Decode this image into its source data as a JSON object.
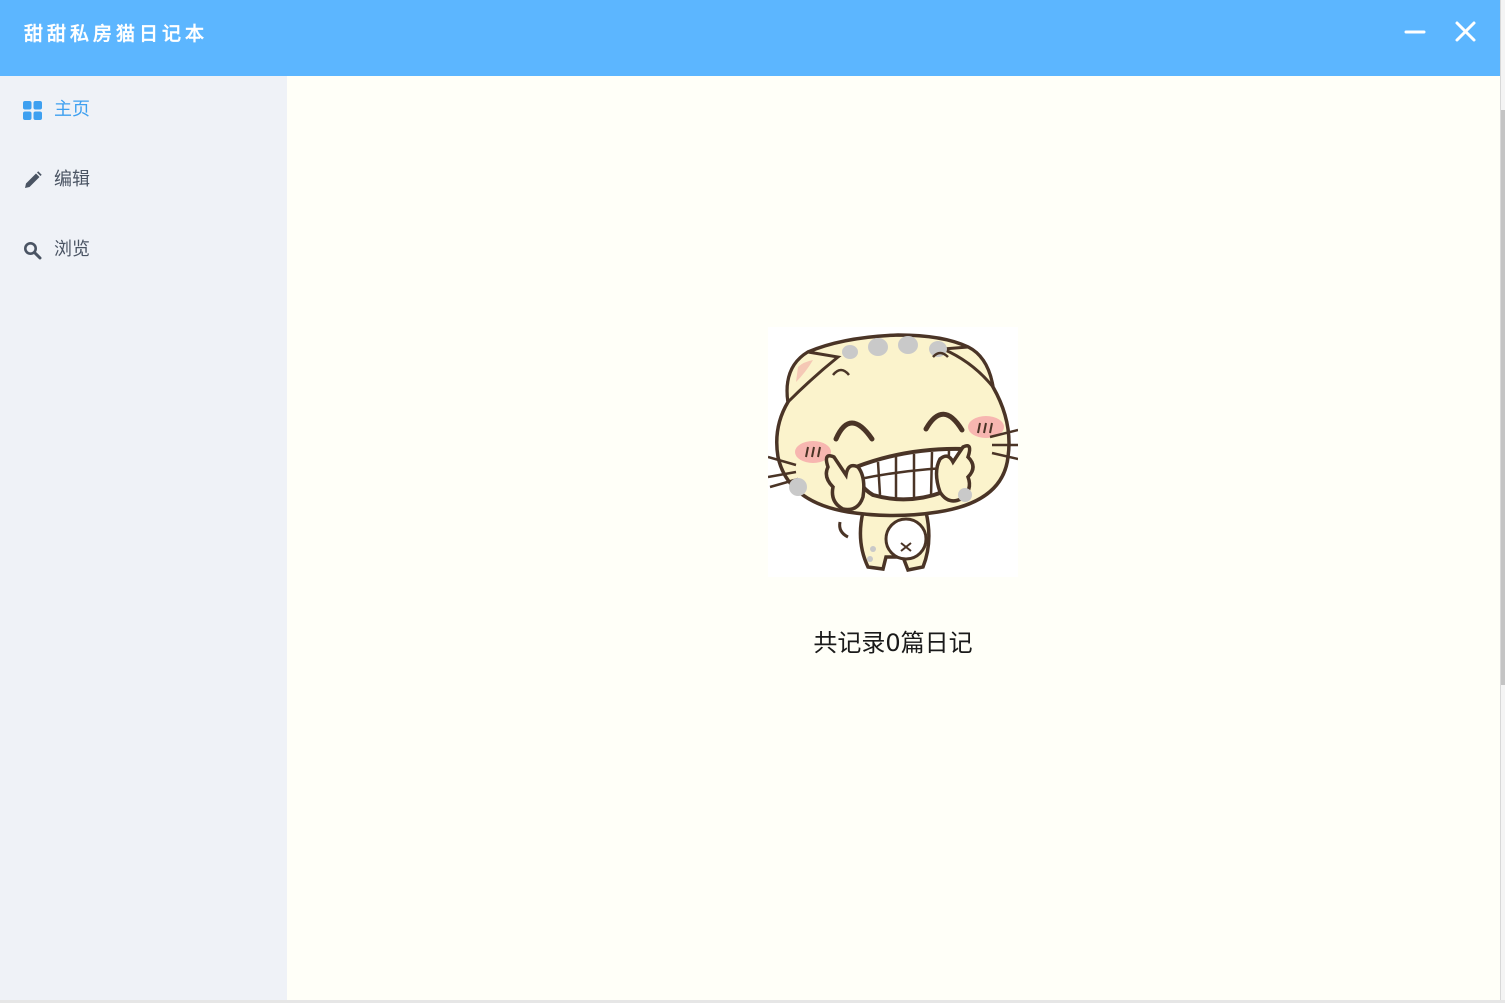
{
  "window": {
    "title": "甜甜私房猫日记本",
    "accent_color": "#5cb6ff",
    "minimize_icon": "minus",
    "close_icon": "x"
  },
  "sidebar": {
    "items": [
      {
        "label": "主页",
        "icon": "grid-icon",
        "active": true
      },
      {
        "label": "编辑",
        "icon": "pencil-icon",
        "active": false
      },
      {
        "label": "浏览",
        "icon": "search-icon",
        "active": false
      }
    ],
    "active_color": "#3ea0f0"
  },
  "main": {
    "illustration": "smiling cartoon cat",
    "diary_count_text": "共记录0篇日记"
  }
}
